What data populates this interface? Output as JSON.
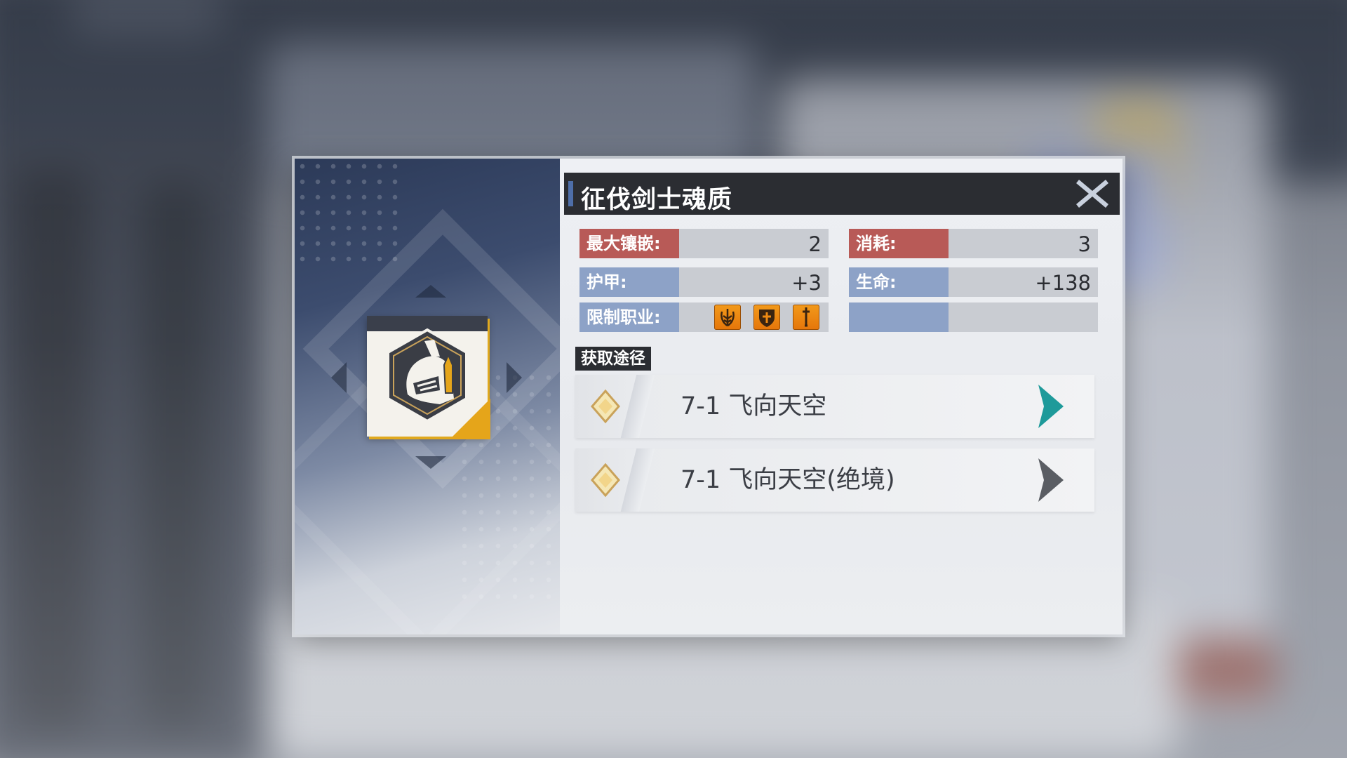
{
  "item": {
    "title": "征伐剑士魂质",
    "icon": "knight-helmet-icon"
  },
  "stats": {
    "max_inlay": {
      "label": "最大镶嵌:",
      "value": "2"
    },
    "cost": {
      "label": "消耗:",
      "value": "3"
    },
    "armor": {
      "label": "护甲:",
      "value": "+3"
    },
    "hp": {
      "label": "生命:",
      "value": "+138"
    },
    "restricted_class": {
      "label": "限制职业:",
      "icons": [
        "laurel-emblem-icon",
        "shield-cross-icon",
        "sword-icon"
      ]
    }
  },
  "sources": {
    "header": "获取途径",
    "routes": [
      {
        "name": "7-1 飞向天空",
        "arrow": "teal-chevron-icon"
      },
      {
        "name": "7-1 飞向天空(绝境)",
        "arrow": "gray-chevron-icon"
      }
    ]
  },
  "colors": {
    "title_bar": "#2b2d32",
    "label_red": "#b85a57",
    "label_blue": "#8da2c7",
    "accent_gold": "#e5a51a",
    "class_icon_orange": "#ee8a12",
    "arrow_teal": "#1e9a9a",
    "arrow_gray": "#5a5d63"
  }
}
